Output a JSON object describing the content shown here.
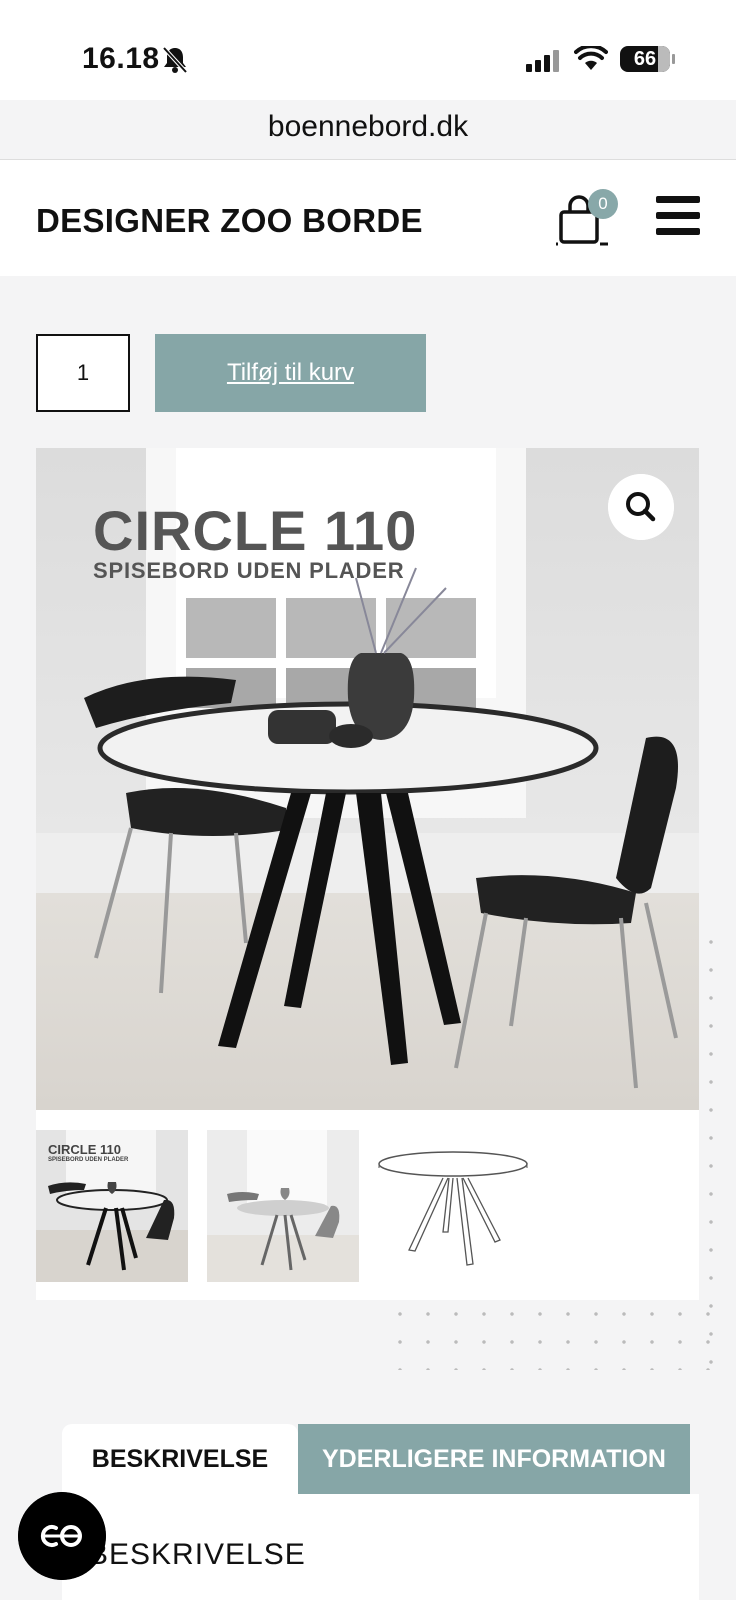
{
  "status_bar": {
    "time": "16.18",
    "battery": "66"
  },
  "browser": {
    "url": "boennebord.dk"
  },
  "header": {
    "logo": "DESIGNER ZOO BORDE",
    "cart_count": "0"
  },
  "purchase": {
    "quantity": "1",
    "add_to_cart_label": "Tilføj til kurv"
  },
  "product_image": {
    "title": "CIRCLE 110",
    "subtitle": "SPISEBORD UDEN PLADER"
  },
  "thumbnails": [
    {
      "title": "CIRCLE 110",
      "subtitle": "SPISEBORD UDEN PLADER"
    },
    {
      "title": "",
      "subtitle": ""
    },
    {
      "title": "",
      "subtitle": ""
    }
  ],
  "tabs": [
    {
      "label": "BESKRIVELSE",
      "active": true
    },
    {
      "label": "YDERLIGERE INFORMATION",
      "active": false
    }
  ],
  "panel": {
    "heading": "BESKRIVELSE"
  },
  "colors": {
    "accent": "#86a6a7",
    "text": "#111111",
    "background": "#f4f4f5"
  },
  "icons": [
    "bell-slash-icon",
    "signal-icon",
    "wifi-icon",
    "battery-icon",
    "cart-icon",
    "menu-icon",
    "search-icon",
    "chat-icon"
  ]
}
